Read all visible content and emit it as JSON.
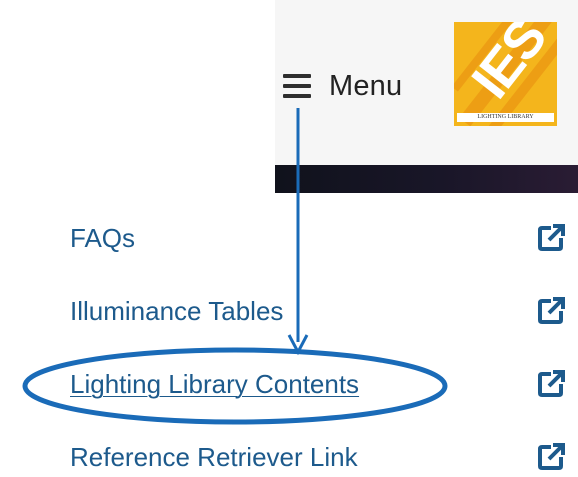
{
  "header": {
    "menu_label": "Menu",
    "logo_text": "IES",
    "logo_subtext": "LIGHTING LIBRARY"
  },
  "links": [
    {
      "label": "FAQs"
    },
    {
      "label": "Illuminance Tables"
    },
    {
      "label": "Lighting Library Contents"
    },
    {
      "label": "Reference Retriever Link"
    }
  ],
  "colors": {
    "link": "#1d5a8c",
    "annotation": "#1a6bb8",
    "logo_bg": "#f4b51c"
  },
  "icons": {
    "menu": "hamburger-icon",
    "external": "external-link-icon"
  }
}
